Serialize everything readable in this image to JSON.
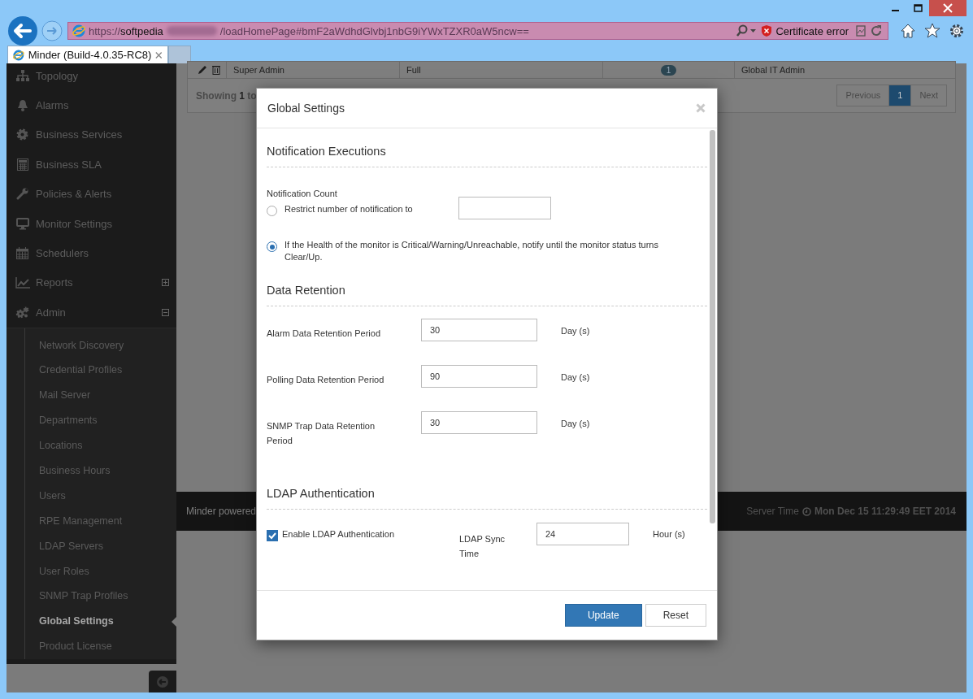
{
  "browser": {
    "url_scheme": "https://",
    "url_host": "softpedia",
    "url_path": "/loadHomePage#bmF2aWdhdGlvbj1nbG9iYWxTZXR0aW5ncw==",
    "certificate_status": "Certificate error",
    "tabs": [
      {
        "title": "Minder (Build-4.0.35-RC8)",
        "selected": true
      }
    ]
  },
  "sidebar": {
    "items": [
      {
        "label": "Topology"
      },
      {
        "label": "Alarms"
      },
      {
        "label": "Business Services"
      },
      {
        "label": "Business SLA"
      },
      {
        "label": "Policies & Alerts"
      },
      {
        "label": "Monitor Settings"
      },
      {
        "label": "Schedulers"
      },
      {
        "label": "Reports",
        "expanded": false
      },
      {
        "label": "Admin",
        "expanded": true,
        "children": [
          {
            "label": "Network Discovery",
            "selected": false
          },
          {
            "label": "Credential Profiles",
            "selected": false
          },
          {
            "label": "Mail Server",
            "selected": false
          },
          {
            "label": "Departments",
            "selected": false
          },
          {
            "label": "Locations",
            "selected": false
          },
          {
            "label": "Business Hours",
            "selected": false
          },
          {
            "label": "Users",
            "selected": false
          },
          {
            "label": "RPE Management",
            "selected": false
          },
          {
            "label": "LDAP Servers",
            "selected": false
          },
          {
            "label": "User Roles",
            "selected": false
          },
          {
            "label": "SNMP Trap Profiles",
            "selected": false
          },
          {
            "label": "Global Settings",
            "selected": true
          },
          {
            "label": "Product License",
            "selected": false
          }
        ]
      }
    ]
  },
  "table": {
    "row": {
      "role": "Super Admin",
      "access": "Full",
      "count": "1",
      "group": "Global IT Admin"
    },
    "showing": "Showing **1** to",
    "pagination": [
      {
        "label": "Previous",
        "selected": false
      },
      {
        "label": "1",
        "selected": true
      },
      {
        "label": "Next",
        "selected": false
      }
    ]
  },
  "footer": {
    "left": "Minder powered",
    "server_time_label": "Server Time",
    "server_time": "Mon Dec 15 11:29:49 EET 2014"
  },
  "modal": {
    "title": "Global Settings",
    "notification": {
      "title": "Notification Executions",
      "field_label": "Notification Count",
      "options": [
        {
          "label": "Restrict number of notification to",
          "selected": false,
          "has_input": true
        },
        {
          "label": "If the Health of the monitor is Critical/Warning/Unreachable, notify until the monitor status turns Clear/Up.",
          "selected": true,
          "has_input": false
        }
      ]
    },
    "retention": {
      "title": "Data Retention",
      "rows": [
        {
          "label": "Alarm Data Retention Period",
          "value": "30",
          "unit": "Day (s)"
        },
        {
          "label": "Polling Data Retention Period",
          "value": "90",
          "unit": "Day (s)"
        },
        {
          "label": "SNMP Trap Data Retention Period",
          "value": "30",
          "unit": "Day (s)"
        }
      ]
    },
    "ldap": {
      "title": "LDAP Authentication",
      "checkbox": {
        "label": "Enable LDAP Authentication",
        "checked": true
      },
      "sync": {
        "label": "LDAP Sync Time",
        "value": "24",
        "unit": "Hour (s)"
      }
    },
    "buttons": [
      {
        "label": "Update",
        "kind": "primary"
      },
      {
        "label": "Reset",
        "kind": "default"
      }
    ]
  }
}
